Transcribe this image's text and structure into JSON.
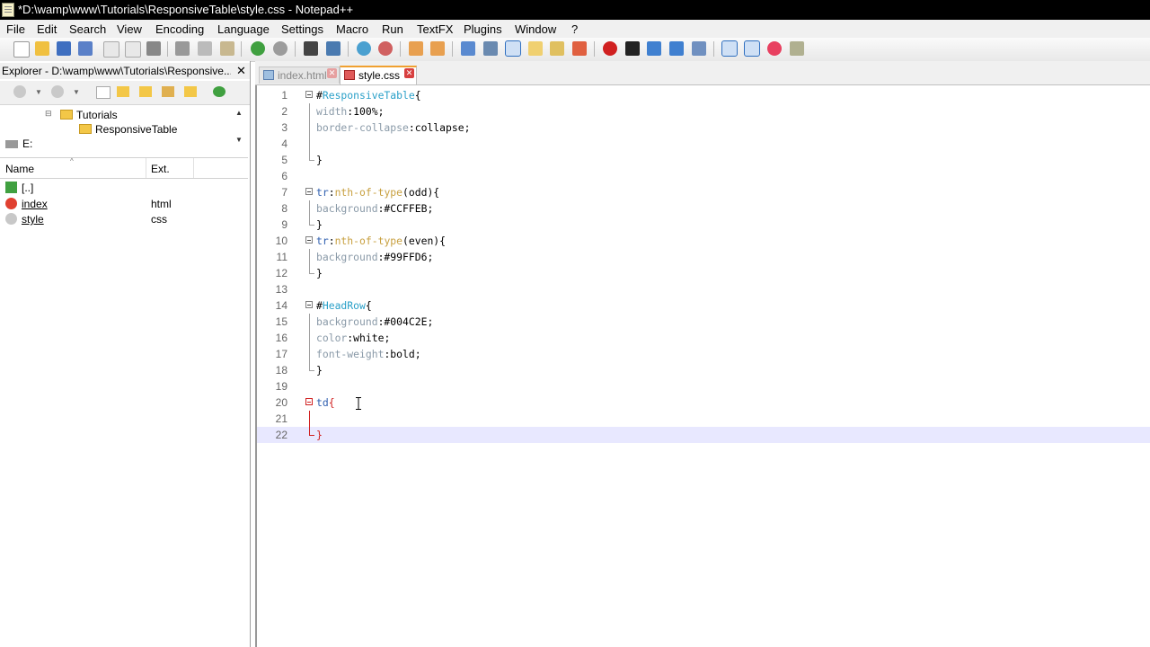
{
  "window": {
    "title": "*D:\\wamp\\www\\Tutorials\\ResponsiveTable\\style.css - Notepad++"
  },
  "menu": [
    "File",
    "Edit",
    "Search",
    "View",
    "Encoding",
    "Language",
    "Settings",
    "Macro",
    "Run",
    "TextFX",
    "Plugins",
    "Window",
    "?"
  ],
  "explorer": {
    "title": "Explorer - D:\\wamp\\www\\Tutorials\\Responsive...",
    "close": "✕",
    "tree": {
      "folder1": "Tutorials",
      "folder2": "ResponsiveTable",
      "drive": "E:"
    },
    "columns": {
      "name": "Name",
      "ext": "Ext."
    },
    "files": [
      {
        "name": "[..]",
        "ext": ""
      },
      {
        "name": "index",
        "ext": "html"
      },
      {
        "name": "style",
        "ext": "css"
      }
    ]
  },
  "tabs": [
    {
      "label": "index.html",
      "active": false
    },
    {
      "label": "style.css",
      "active": true
    }
  ],
  "editor": {
    "line_numbers": [
      "1",
      "2",
      "3",
      "4",
      "5",
      "6",
      "7",
      "8",
      "9",
      "10",
      "11",
      "12",
      "13",
      "14",
      "15",
      "16",
      "17",
      "18",
      "19",
      "20",
      "21",
      "22"
    ],
    "code": {
      "l1": {
        "a": "#",
        "b": "ResponsiveTable",
        "c": "{"
      },
      "l2": {
        "a": "width",
        "b": ":100%;"
      },
      "l3": {
        "a": "border-collapse",
        "b": ":collapse;"
      },
      "l5": "}",
      "l7": {
        "a": "tr",
        "b": ":",
        "c": "nth-of-type",
        "d": "(odd){"
      },
      "l8": {
        "a": "background",
        "b": ":#CCFFEB;"
      },
      "l9": "}",
      "l10": {
        "a": "tr",
        "b": ":",
        "c": "nth-of-type",
        "d": "(even){"
      },
      "l11": {
        "a": "background",
        "b": ":#99FFD6;"
      },
      "l12": "}",
      "l14": {
        "a": "#",
        "b": "HeadRow",
        "c": "{"
      },
      "l15": {
        "a": "background",
        "b": ":#004C2E;"
      },
      "l16": {
        "a": "color",
        "b": ":white;"
      },
      "l17": {
        "a": "font-weight",
        "b": ":bold;"
      },
      "l18": "}",
      "l20": {
        "a": "td",
        "b": "{"
      },
      "l22": "}"
    }
  }
}
